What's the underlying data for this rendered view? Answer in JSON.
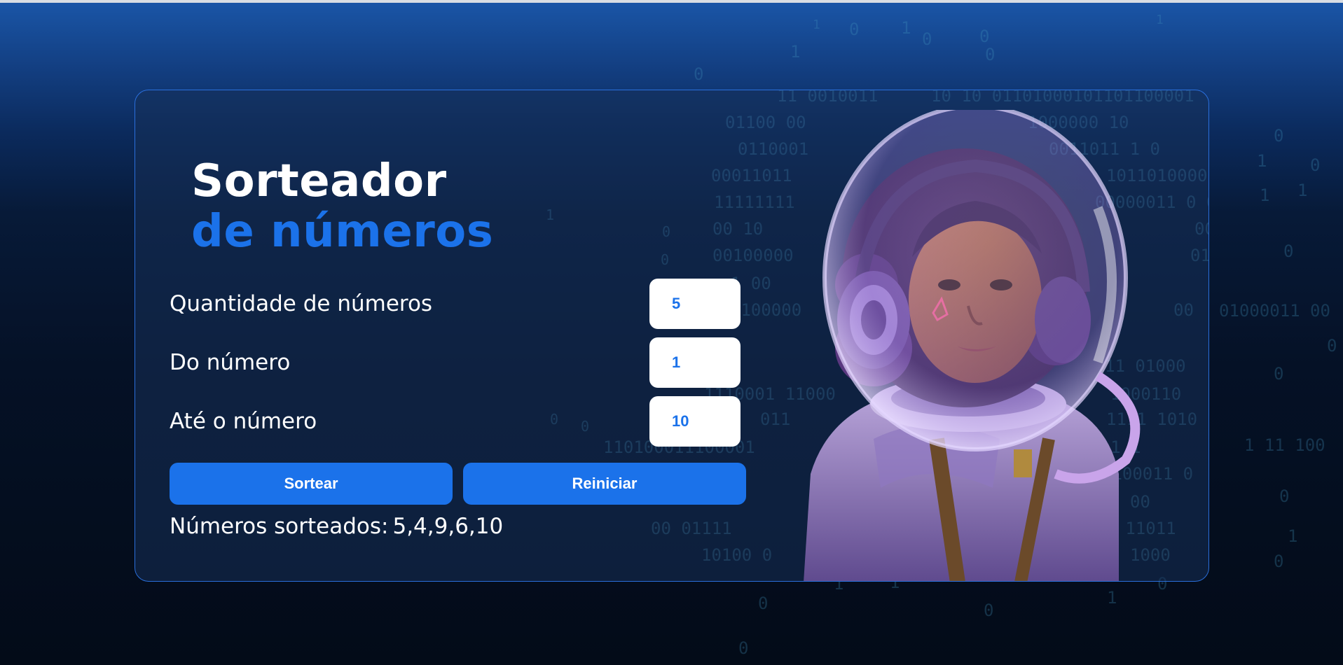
{
  "page": {
    "title_line1": "Sorteador",
    "title_line2": "de números"
  },
  "form": {
    "quantity": {
      "label": "Quantidade de números",
      "value": "5"
    },
    "from": {
      "label": "Do número",
      "value": "1"
    },
    "to": {
      "label": "Até o número",
      "value": "10"
    }
  },
  "buttons": {
    "draw_label": "Sortear",
    "reset_label": "Reiniciar"
  },
  "result": {
    "label": "Números sorteados:",
    "value": "5,4,9,6,10"
  },
  "illustration": {
    "icon": "astronaut-girl-illustration"
  },
  "colors": {
    "accent": "#1b72ea",
    "title": "#ffffff",
    "card_border": "#2a6fdc",
    "background_dark": "#030b18"
  }
}
